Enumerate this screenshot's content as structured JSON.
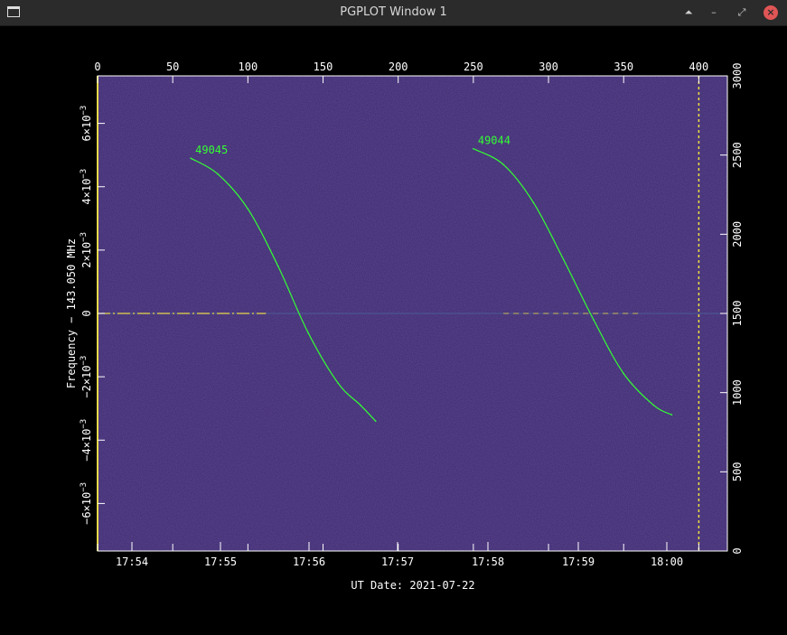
{
  "window": {
    "title": "PGPLOT Window 1",
    "icons": [
      "app-window-icon",
      "shade-icon",
      "minimize-icon",
      "restore-icon",
      "close-icon"
    ],
    "close_symbol": "×",
    "shade_symbol": "⏶",
    "minimize_symbol": "–",
    "restore_symbol": "⤢"
  },
  "colors": {
    "background": "#000000",
    "plot_fill": "#3a2a6e",
    "frame": "#ffffff",
    "trace": "#33ff33",
    "center_line": "#e8d84a",
    "marker_line": "#f0e040",
    "text": "#ffffff"
  },
  "chart_data": {
    "type": "spectrogram",
    "xlabel": "UT Date: 2021-07-22",
    "ylabel": "Frequency  −  143.050 MHz",
    "x_top": {
      "ticks": [
        "0",
        "50",
        "100",
        "150",
        "200",
        "250",
        "300",
        "350",
        "400"
      ],
      "values": [
        0,
        50,
        100,
        150,
        200,
        250,
        300,
        350,
        400
      ],
      "range": [
        0,
        419
      ]
    },
    "x_bottom": {
      "ticks": [
        "17:54",
        "17:55",
        "17:56",
        "17:57",
        "17:58",
        "17:59",
        "18:00"
      ]
    },
    "y_left": {
      "range": [
        -0.0075,
        0.0075
      ],
      "ticks": [
        {
          "value": 0.006,
          "mant": "6×10",
          "exp": "−3"
        },
        {
          "value": 0.004,
          "mant": "4×10",
          "exp": "−3"
        },
        {
          "value": 0.002,
          "mant": "2×10",
          "exp": "−3"
        },
        {
          "value": 0,
          "mant": "0",
          "exp": ""
        },
        {
          "value": -0.002,
          "mant": "−2×10",
          "exp": "−3"
        },
        {
          "value": -0.004,
          "mant": "−4×10",
          "exp": "−3"
        },
        {
          "value": -0.006,
          "mant": "−6×10",
          "exp": "−3"
        }
      ]
    },
    "y_right": {
      "range": [
        0,
        3000
      ],
      "ticks": [
        "0",
        "500",
        "1000",
        "1500",
        "2000",
        "2500",
        "3000"
      ],
      "values": [
        0,
        500,
        1000,
        1500,
        2000,
        2500,
        3000
      ]
    },
    "marker_x": 400,
    "series": [
      {
        "name": "49045",
        "x": [
          62,
          80,
          100,
          120,
          140,
          160,
          175,
          185
        ],
        "y": [
          0.0049,
          0.0044,
          0.0033,
          0.0015,
          -0.0006,
          -0.0022,
          -0.0029,
          -0.0034
        ]
      },
      {
        "name": "49044",
        "x": [
          250,
          270,
          290,
          310,
          330,
          350,
          370,
          382
        ],
        "y": [
          0.0052,
          0.0047,
          0.0035,
          0.0017,
          -0.0002,
          -0.0019,
          -0.0029,
          -0.0032
        ]
      }
    ]
  }
}
